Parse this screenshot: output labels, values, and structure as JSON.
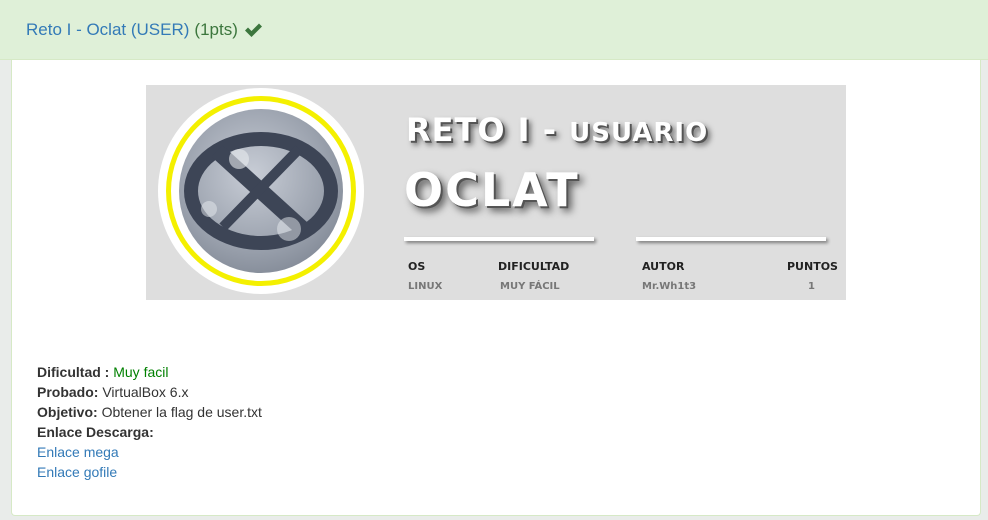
{
  "header": {
    "title_link": "Reto I - Oclat (USER)",
    "points": "(1pts)",
    "check_icon": "check-icon",
    "accent_color": "#3c763d"
  },
  "banner": {
    "title_line1_big": "RETO I - ",
    "title_line1_small": "USUARIO",
    "title_line2": "OCLAT",
    "columns": [
      {
        "header": "OS",
        "value": "LINUX"
      },
      {
        "header": "DIFICULTAD",
        "value": "MUY FÁCIL"
      },
      {
        "header": "AUTOR",
        "value": "Mr.Wh1t3"
      },
      {
        "header": "PUNTOS",
        "value": "1"
      }
    ]
  },
  "details": {
    "difficulty_label": "Dificultad :",
    "difficulty_value": "Muy facil",
    "tested_label": "Probado:",
    "tested_value": "VirtualBox 6.x",
    "objective_label": "Objetivo:",
    "objective_value": "Obtener la flag de user.txt",
    "download_label": "Enlace Descarga:",
    "link_mega": "Enlace mega",
    "link_gofile": "Enlace gofile"
  }
}
